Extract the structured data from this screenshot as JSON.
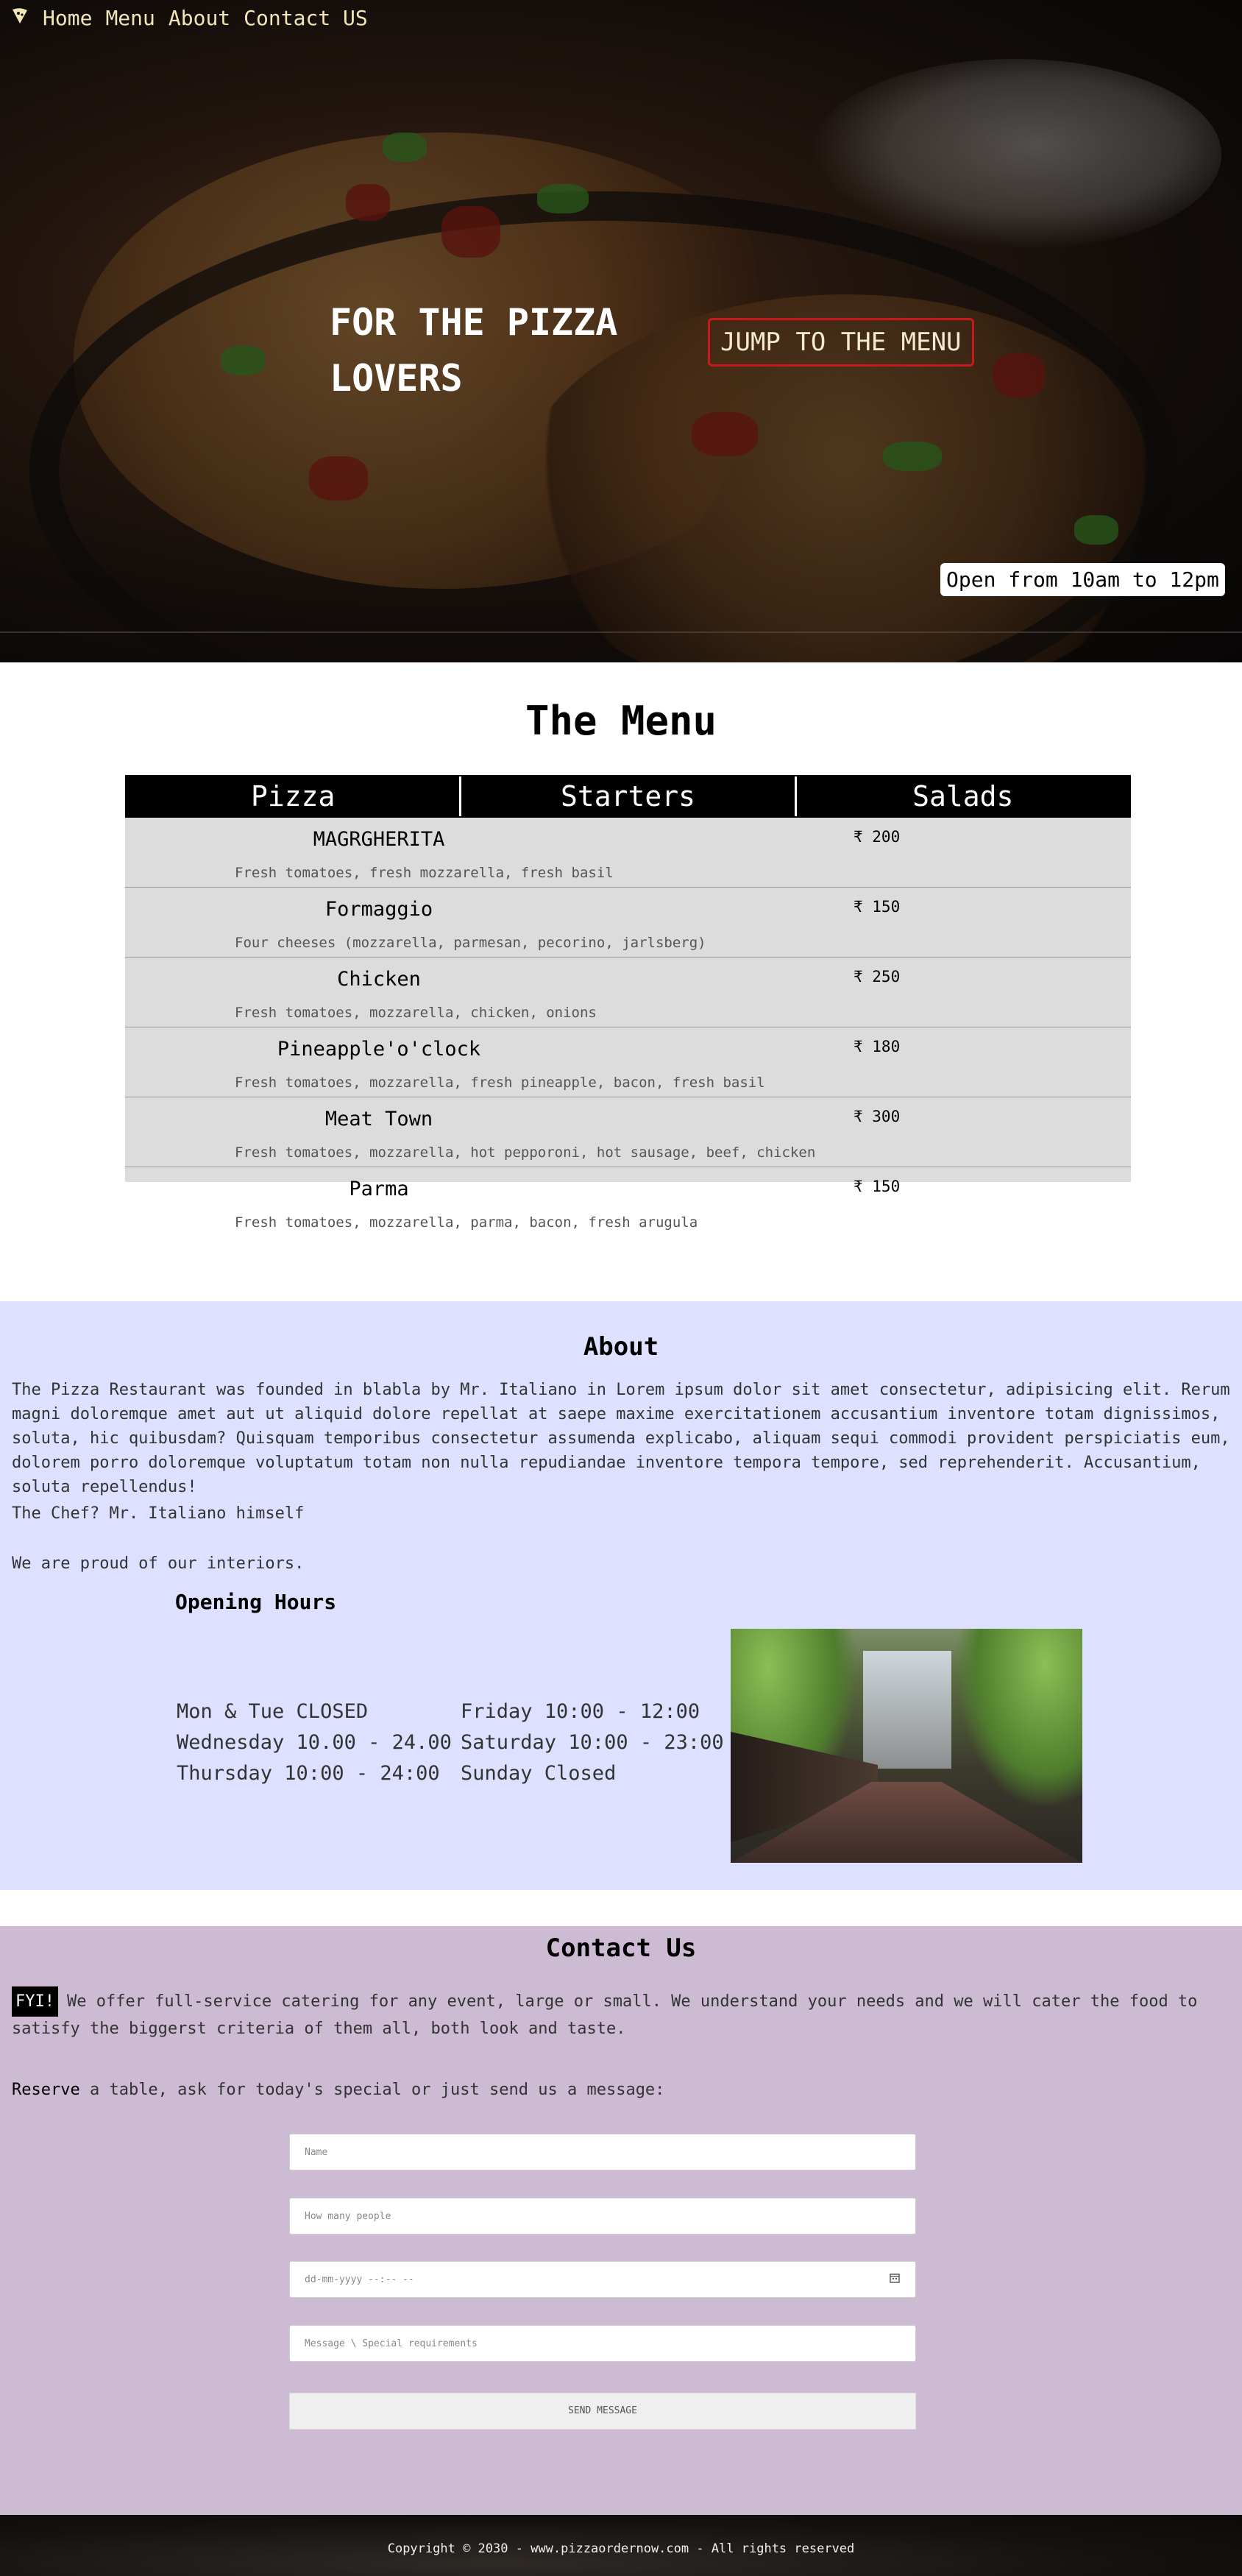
{
  "nav": {
    "logo_icon": "pizza-slice-icon",
    "links": [
      "Home",
      "Menu",
      "About",
      "Contact US"
    ]
  },
  "hero": {
    "title": "FOR THE PIZZA LOVERS",
    "menu_button": "JUMP TO THE MENU",
    "hours_badge": "Open from 10am to 12pm"
  },
  "menu": {
    "title": "The Menu",
    "tabs": [
      "Pizza",
      "Starters",
      "Salads"
    ],
    "items": [
      {
        "name": "MAGRGHERITA",
        "price": "₹ 200",
        "desc": "Fresh tomatoes, fresh mozzarella, fresh basil"
      },
      {
        "name": "Formaggio",
        "price": "₹ 150",
        "desc": "Four cheeses (mozzarella, parmesan, pecorino, jarlsberg)"
      },
      {
        "name": "Chicken",
        "price": "₹ 250",
        "desc": "Fresh tomatoes, mozzarella, chicken, onions"
      },
      {
        "name": "Pineapple'o'clock",
        "price": "₹ 180",
        "desc": "Fresh tomatoes, mozzarella, fresh pineapple, bacon, fresh basil"
      },
      {
        "name": "Meat Town",
        "price": "₹ 300",
        "desc": "Fresh tomatoes, mozzarella, hot pepporoni, hot sausage, beef, chicken"
      },
      {
        "name": "Parma",
        "price": "₹ 150",
        "desc": "Fresh tomatoes, mozzarella, parma, bacon, fresh arugula"
      }
    ]
  },
  "about": {
    "title": "About",
    "paragraph": "The Pizza Restaurant was founded in blabla by Mr. Italiano in Lorem ipsum dolor sit amet consectetur, adipisicing elit. Rerum magni doloremque amet aut ut aliquid dolore repellat at saepe maxime exercitationem accusantium inventore totam dignissimos, soluta, hic quibusdam? Quisquam temporibus consectetur assumenda explicabo, aliquam sequi commodi provident perspiciatis eum, dolorem porro doloremque voluptatum totam non nulla repudiandae inventore tempora tempore, sed reprehenderit. Accusantium, soluta repellendus!",
    "chef": "The Chef? Mr. Italiano himself",
    "interiors": "We are proud of our interiors.",
    "opening_title": "Opening Hours",
    "hours": [
      "Mon & Tue CLOSED",
      "Friday 10:00 - 12:00",
      "Wednesday 10.00 - 24.00",
      "Saturday 10:00 - 23:00",
      "Thursday 10:00 - 24:00",
      "Sunday Closed"
    ]
  },
  "contact": {
    "title": "Contact Us",
    "fyi": "FYI!",
    "catering": "We offer full-service catering for any event, large or small. We understand your needs and we will cater the food to satisfy the biggerst criteria of them all, both look and taste.",
    "reserve_bold": "Reserve",
    "reserve_rest": " a table, ask for today's special or just send us a message:",
    "name_placeholder": "Name",
    "people_placeholder": "How many people",
    "datetime_placeholder": "dd-mm-yyyy --:-- --",
    "calendar_icon": "calendar-icon",
    "message_placeholder": "Message \\ Special requirements",
    "send_label": "SEND MESSAGE"
  },
  "footer": {
    "copyright": "Copyright © 2030 - www.pizzaordernow.com - All rights reserved"
  }
}
